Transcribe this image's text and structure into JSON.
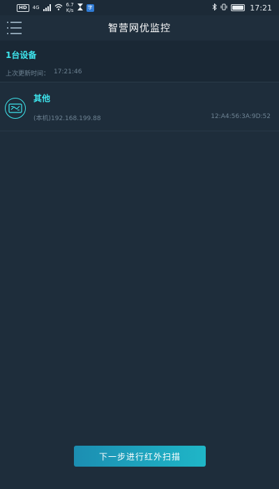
{
  "status_bar": {
    "hd_badge": "HD",
    "network_type": "4G",
    "speed_value": "6.7",
    "speed_unit": "K/s",
    "time": "17:21"
  },
  "header": {
    "title": "智营网优监控"
  },
  "summary": {
    "device_count": "1台设备",
    "last_update_label": "上次更新时间：",
    "last_update_time": "17:21:46"
  },
  "devices": [
    {
      "name": "其他",
      "ip": "(本机)192.168.199.88",
      "mac": "12:A4:56:3A:9D:52",
      "icon": "network-device-icon"
    }
  ],
  "next_button": {
    "label": "下一步进行红外扫描"
  },
  "colors": {
    "accent": "#3ee6ee",
    "background": "#1e2d3b",
    "button_start": "#1c8eb2",
    "button_end": "#1fb6c7"
  }
}
